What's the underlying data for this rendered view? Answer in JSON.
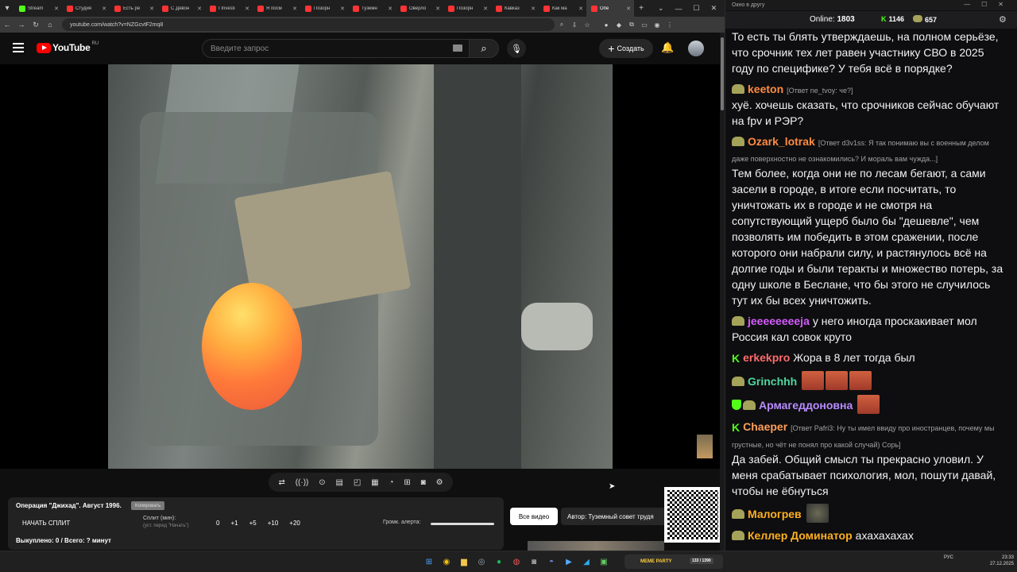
{
  "browser": {
    "tabs": [
      {
        "label": "Stream",
        "color": "#53fc18"
      },
      {
        "label": "Студия",
        "color": "#ff3333"
      },
      {
        "label": "Есть ре",
        "color": "#ff3333"
      },
      {
        "label": "С Девон",
        "color": "#ff3333"
      },
      {
        "label": "I Investi",
        "color": "#ff3333"
      },
      {
        "label": "Я посм",
        "color": "#ff3333"
      },
      {
        "label": "Позорн",
        "color": "#ff3333"
      },
      {
        "label": "Туземн",
        "color": "#ff3333"
      },
      {
        "label": "Оверло",
        "color": "#ff3333"
      },
      {
        "label": "Позорн",
        "color": "#ff3333"
      },
      {
        "label": "Кавказ",
        "color": "#ff3333"
      },
      {
        "label": "Как ма",
        "color": "#ff3333"
      },
      {
        "label": "Опе",
        "color": "#ff3333",
        "active": true
      }
    ],
    "url": "youtube.com/watch?v=NZGcvtF2mq8"
  },
  "youtube": {
    "logo": "YouTube",
    "region": "RU",
    "search_placeholder": "Введите запрос",
    "create_label": "Создать"
  },
  "extension": {
    "title": "Операция \"Джихад\". Август 1996.",
    "copy_label": "Копировать",
    "start_split": "НАЧАТЬ СПЛИТ",
    "split_label": "Сплит (мин):",
    "split_hint": "(уст. перед \"Начать\")",
    "split_values": [
      "0",
      "+1",
      "+5",
      "+10",
      "+20"
    ],
    "alert_volume_label": "Громк. алерта:",
    "alert_volume": 1.0,
    "bought": "Выкуплено: 0 / Всего: ? минут",
    "all_videos": "Все видео",
    "author": "Автор: Туземный совет трудя"
  },
  "chat": {
    "window_title": "Окно в другу",
    "online_label": "Online:",
    "online_count": "1803",
    "kick_count": "1146",
    "points_count": "657",
    "messages": [
      {
        "icon": "none",
        "user": "",
        "user_color": "#ffffff",
        "reply": "",
        "text": "То есть ты блять утверждаешь, на полном серьёзе, что срочник тех лет равен участнику СВО в 2025 году по специфике? У тебя всё в порядке?"
      },
      {
        "icon": "badge",
        "user": "keeton",
        "user_color": "#ff8c42",
        "reply": "[Ответ ne_tvoy: че?]",
        "text": "хуё. хочешь сказать, что срочников сейчас обучают на fpv и РЭР?"
      },
      {
        "icon": "badge",
        "user": "Ozark_lotrak",
        "user_color": "#ff8c42",
        "reply": "[Ответ d3v1ss: Я так понимаю вы с военным делом даже поверхностно не ознакомились? И мораль вам чужда...]",
        "text": "Тем более, когда они не по лесам бегают, а сами засели в городе, в итоге если посчитать, то уничтожать их в городе и не смотря на сопутствующий ущерб было бы \"дешевле\", чем позволять им победить в этом сражении, после которого они набрали силу, и растянулось всё на долгие годы и были теракты и множество потерь, за одну школе в Беслане, что бы этого не случилось тут их бы всех уничтожить."
      },
      {
        "icon": "badge",
        "user": "jeeeeeeeeja",
        "user_color": "#d65cff",
        "reply": "",
        "text": "у него иногда проскакивает мол Россия кал совок круто"
      },
      {
        "icon": "kick",
        "user": "erkekpro",
        "user_color": "#ff6b6b",
        "reply": "",
        "text": "Жора в 8 лет тогда был"
      },
      {
        "icon": "badge",
        "user": "Grinchhh",
        "user_color": "#4fd6a0",
        "reply": "",
        "text": "",
        "emotes": 3
      },
      {
        "icon": "shield",
        "user": "Армагеддоновна",
        "user_color": "#b88cff",
        "reply": "",
        "text": "",
        "emotes": 1
      },
      {
        "icon": "kick",
        "user": "Chaeper",
        "user_color": "#ff9f5a",
        "reply": "[Ответ Pafri3: Ну ты имел ввиду про иностранцев, почему мы грустные, но чёт не понял про какой случай) Сорь]",
        "text": "Да забей. Общий смысл ты прекрасно уловил. У меня срабатывает психология, мол, пошути давай, чтобы не ёбнуться"
      },
      {
        "icon": "badge",
        "user": "Малогрев",
        "user_color": "#ffb020",
        "reply": "",
        "text": "",
        "emotes": 1,
        "emote_style": "g"
      },
      {
        "icon": "badge",
        "user": "Келлер Доминатор",
        "user_color": "#ffb020",
        "reply": "",
        "text": "ахахахахах"
      }
    ]
  },
  "taskbar": {
    "meme_party": "MEME PARTY",
    "meme_count": "133 / 1390",
    "lang": "РУС",
    "time": "23:33",
    "date": "27.12.2025"
  }
}
